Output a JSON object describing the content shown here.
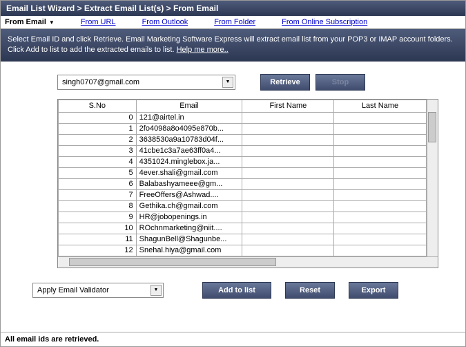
{
  "title": "Email List Wizard > Extract Email List(s) > From Email",
  "tabs": {
    "current": "From Email",
    "url": "From URL",
    "outlook": "From Outlook",
    "folder": "From Folder",
    "online": "From Online Subscription"
  },
  "instructions": {
    "text": "Select Email ID and click Retrieve. Email Marketing Software Express will extract email list from your POP3 or IMAP account folders. Click Add to list to add the extracted emails to list. ",
    "help": "Help me more.."
  },
  "email_combo": "singh0707@gmail.com",
  "buttons": {
    "retrieve": "Retrieve",
    "stop": "Stop",
    "addtolist": "Add to list",
    "reset": "Reset",
    "export": "Export"
  },
  "columns": {
    "sno": "S.No",
    "email": "Email",
    "first": "First Name",
    "last": "Last Name"
  },
  "rows": [
    {
      "n": "0",
      "email": "121@airtel.in"
    },
    {
      "n": "1",
      "email": "2fo4098a8o4095e870b..."
    },
    {
      "n": "2",
      "email": "3638530a9a10783d04f..."
    },
    {
      "n": "3",
      "email": "41cbe1c3a7ae63ff0a4..."
    },
    {
      "n": "4",
      "email": "4351024.minglebox.ja..."
    },
    {
      "n": "5",
      "email": "4ever.shali@gmail.com"
    },
    {
      "n": "6",
      "email": "Balabashyameee@gm..."
    },
    {
      "n": "7",
      "email": "FreeOffers@Ashwad...."
    },
    {
      "n": "8",
      "email": "Gethika.ch@gmail.com"
    },
    {
      "n": "9",
      "email": "HR@jobopenings.in"
    },
    {
      "n": "10",
      "email": "ROchnmarketing@niit...."
    },
    {
      "n": "11",
      "email": "ShagunBell@Shagunbe..."
    },
    {
      "n": "12",
      "email": "Snehal.hiya@gmail.com"
    }
  ],
  "validator_combo": "Apply Email Validator",
  "status": "All email ids are retrieved."
}
